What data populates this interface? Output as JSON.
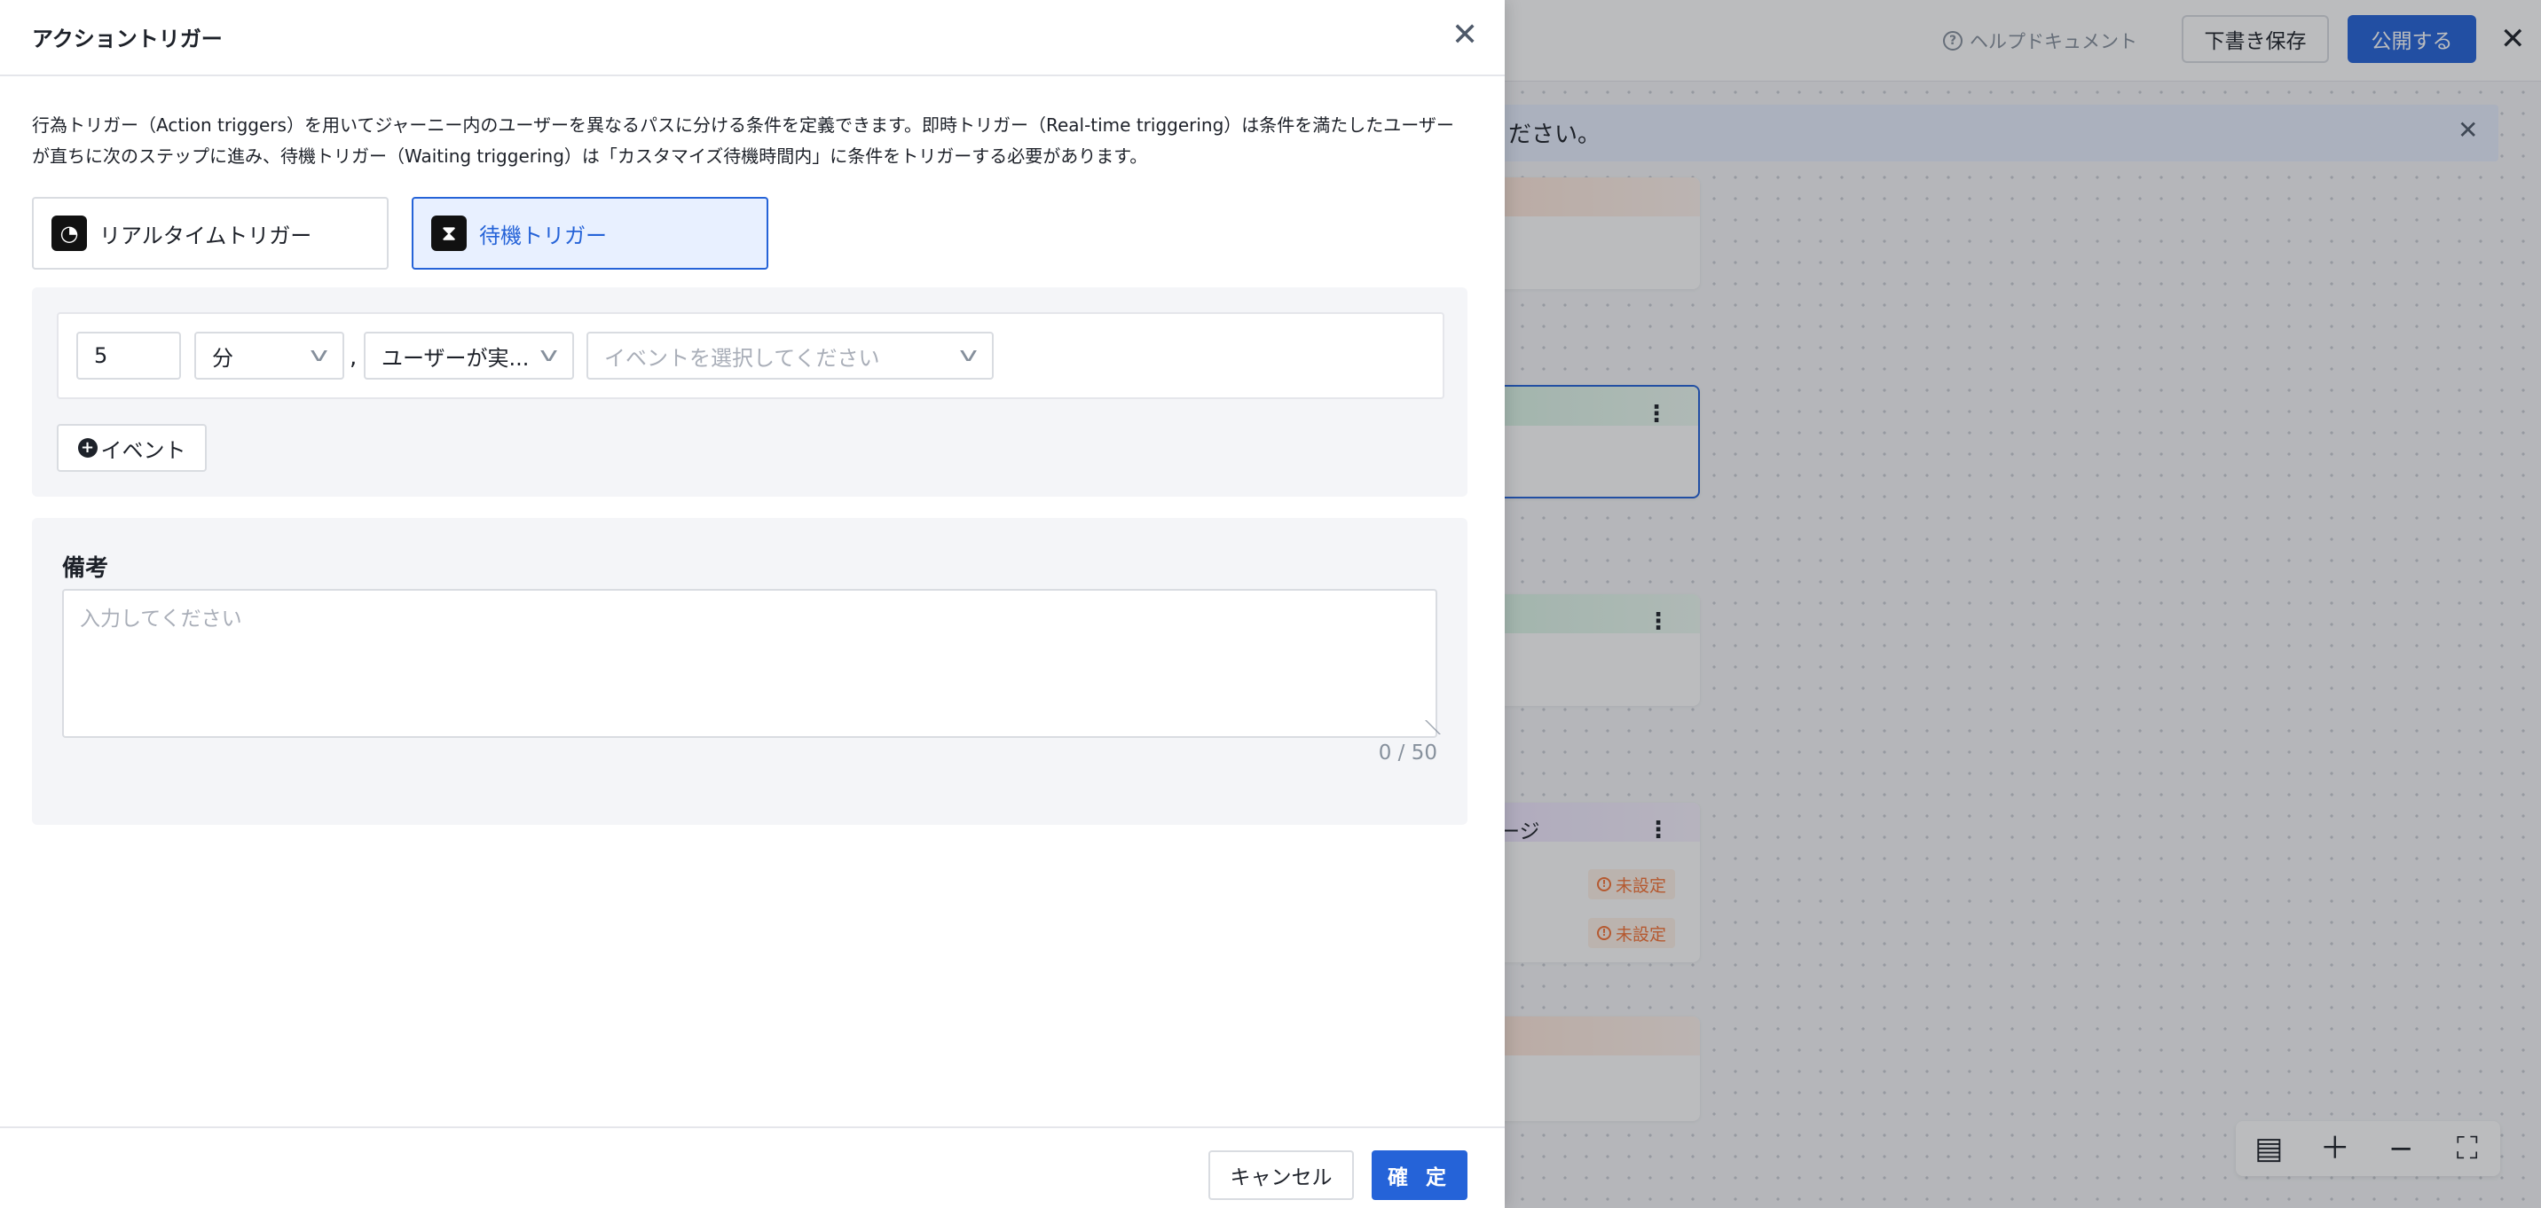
{
  "background": {
    "help_label": "ヘルプドキュメント",
    "draft_label": "下書き保存",
    "publish_label": "公開する",
    "banner_text": "ださい。",
    "node4_title": "ージ",
    "tag_unset_1": "未設定",
    "tag_unset_2": "未設定"
  },
  "drawer": {
    "title": "アクショントリガー",
    "description": "行為トリガー（Action triggers）を用いてジャーニー内のユーザーを異なるパスに分ける条件を定義できます。即時トリガー（Real-time triggering）は条件を満たしたユーザーが直ちに次のステップに進み、待機トリガー（Waiting triggering）は「カスタマイズ待機時間内」に条件をトリガーする必要があります。",
    "options": [
      {
        "label": "リアルタイムトリガー",
        "selected": false
      },
      {
        "label": "待機トリガー",
        "selected": true
      }
    ],
    "condition": {
      "wait_value": "5",
      "unit": "分",
      "separator": ",",
      "action": "ユーザーが実...",
      "event_placeholder": "イベントを選択してください"
    },
    "add_event_label": "イベント",
    "memo": {
      "label": "備考",
      "placeholder": "入力してください",
      "counter": "0 / 50"
    },
    "cancel_label": "キャンセル",
    "confirm_label": "確 定"
  },
  "colors": {
    "primary": "#2563d8",
    "selected_bg": "#e8f0ff",
    "warning": "#f77234"
  }
}
